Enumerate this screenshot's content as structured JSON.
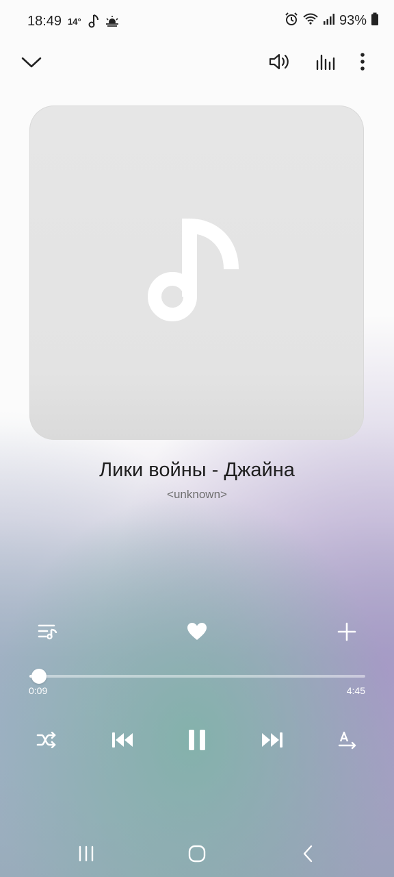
{
  "status_bar": {
    "time": "18:49",
    "temperature": "14°",
    "battery": "93%",
    "icons": [
      "music-note-icon",
      "weather-icon",
      "alarm-icon",
      "wifi-icon",
      "signal-icon",
      "battery-icon"
    ]
  },
  "top_bar": {
    "icons": [
      "chevron-down-icon",
      "volume-icon",
      "equalizer-icon",
      "more-vert-icon"
    ]
  },
  "track": {
    "title": "Лики войны - Джайна",
    "artist": "<unknown>",
    "art_icon": "music-note-icon"
  },
  "actions": {
    "icons": [
      "queue-icon",
      "heart-icon",
      "add-icon"
    ]
  },
  "progress": {
    "elapsed": "0:09",
    "total": "4:45",
    "fraction": 0.032
  },
  "playback": {
    "icons": [
      "shuffle-icon",
      "previous-icon",
      "pause-icon",
      "next-icon",
      "speed-icon"
    ]
  },
  "nav_bar": {
    "icons": [
      "recent-apps-icon",
      "home-icon",
      "back-icon"
    ]
  },
  "colors": {
    "accent_white": "#ffffff",
    "text_dark": "#1e1e1e",
    "text_muted": "#6e6e6e"
  }
}
